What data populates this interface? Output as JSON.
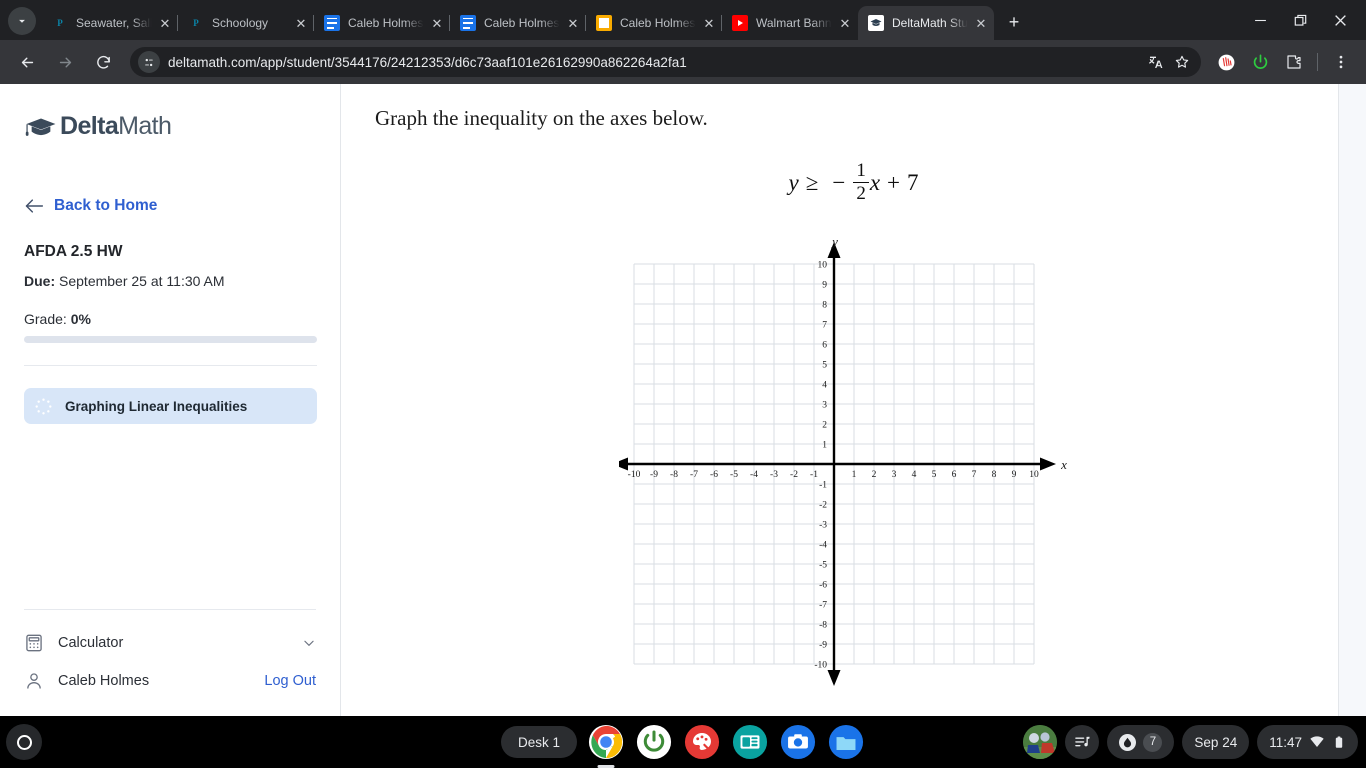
{
  "browser": {
    "tab_search_icon": "chevron-down-icon",
    "tabs": [
      {
        "title": "Seawater, Salinity",
        "favicon": "powerschool-icon",
        "active": false
      },
      {
        "title": "Schoology",
        "favicon": "powerschool-icon",
        "active": false
      },
      {
        "title": "Caleb Holmes - C",
        "favicon": "google-docs-icon",
        "active": false
      },
      {
        "title": "Caleb Holmes - C",
        "favicon": "google-docs-icon",
        "active": false
      },
      {
        "title": "Caleb Holmes - P",
        "favicon": "google-slides-icon",
        "active": false
      },
      {
        "title": "Walmart Banned",
        "favicon": "youtube-icon",
        "active": false
      },
      {
        "title": "DeltaMath Studen",
        "favicon": "deltamath-icon",
        "active": true
      }
    ],
    "new_tab_label": "+",
    "window_controls": [
      "minimize-icon",
      "restore-icon",
      "close-icon"
    ],
    "toolbar": {
      "back_icon": "arrow-left-icon",
      "forward_icon": "arrow-right-icon",
      "reload_icon": "reload-icon",
      "site_info_icon": "site-settings-icon",
      "url": "deltamath.com/app/student/3544176/24212353/d6c73aaf101e26162990a862264a2fa1",
      "translate_icon": "translate-icon",
      "bookmark_icon": "star-icon",
      "extensions": [
        "grammarly-icon",
        "power-icon",
        "extensions-puzzle-icon"
      ],
      "menu_icon": "three-dot-menu-icon"
    }
  },
  "sidebar": {
    "logo": {
      "icon": "graduation-cap-icon",
      "bold": "Delta",
      "light": "Math"
    },
    "back_link": {
      "icon": "arrow-left-icon",
      "label": "Back to Home"
    },
    "assignment_title": "AFDA 2.5 HW",
    "due_label": "Due:",
    "due_value": "September 25 at 11:30 AM",
    "grade_label": "Grade:",
    "grade_value": "0%",
    "progress_percent": 0,
    "problems": [
      {
        "icon": "dotted-circle-progress-icon",
        "label": "Graphing Linear Inequalities"
      }
    ],
    "footer": {
      "calculator_label": "Calculator",
      "calculator_icon": "calculator-icon",
      "calculator_chevron": "chevron-down-icon",
      "user_icon": "person-icon",
      "user_name": "Caleb Holmes",
      "logout_label": "Log Out"
    },
    "accent_color": "#2f5fd0",
    "highlight_color": "#d8e6f8"
  },
  "main": {
    "question": "Graph the inequality on the axes below.",
    "equation": {
      "lhs": "y",
      "relation": "≥",
      "minus": "−",
      "fraction": {
        "numerator": "1",
        "denominator": "2"
      },
      "variable": "x",
      "plus": "+",
      "constant": "7",
      "plain": "y ≥ − 1/2 x + 7"
    }
  },
  "chart_data": {
    "type": "scatter",
    "title": "",
    "xlabel": "x",
    "ylabel": "y",
    "xlim": [
      -10,
      10
    ],
    "ylim": [
      -10,
      10
    ],
    "grid": true,
    "x_ticks": [
      -10,
      -9,
      -8,
      -7,
      -6,
      -5,
      -4,
      -3,
      -2,
      -1,
      1,
      2,
      3,
      4,
      5,
      6,
      7,
      8,
      9,
      10
    ],
    "y_ticks": [
      10,
      9,
      8,
      7,
      6,
      5,
      4,
      3,
      2,
      1,
      -1,
      -2,
      -3,
      -4,
      -5,
      -6,
      -7,
      -8,
      -9,
      -10
    ],
    "x_tick_labels": [
      "-10",
      "-9",
      "-8",
      "-7",
      "-6",
      "-5",
      "-4",
      "-3",
      "-2",
      "-1",
      "1",
      "2",
      "3",
      "4",
      "5",
      "6",
      "7",
      "8",
      "9",
      "10"
    ],
    "y_tick_labels": [
      "10",
      "9",
      "8",
      "7",
      "6",
      "5",
      "4",
      "3",
      "2",
      "1",
      "-1",
      "-2",
      "-3",
      "-4",
      "-5",
      "-6",
      "-7",
      "-8",
      "-9",
      "-10"
    ],
    "series": [],
    "annotations": [],
    "axis_arrows": true,
    "grid_color": "#d9dde3",
    "axis_color": "#000000"
  },
  "shelf": {
    "launcher_icon": "launcher-circle-icon",
    "desk_label": "Desk 1",
    "apps": [
      {
        "name": "chrome-icon",
        "active": true
      },
      {
        "name": "power-app-icon",
        "active": false
      },
      {
        "name": "paint-app-icon",
        "active": false
      },
      {
        "name": "news-app-icon",
        "active": false
      },
      {
        "name": "camera-app-icon",
        "active": false
      },
      {
        "name": "files-app-icon",
        "active": false
      }
    ],
    "status": {
      "avatar_icon": "user-avatar",
      "media_icon": "media-playlist-icon",
      "drive_icon": "drop-icon",
      "notification_count": "7",
      "date": "Sep 24",
      "time": "11:47",
      "wifi_icon": "wifi-icon",
      "battery_icon": "battery-icon"
    }
  }
}
